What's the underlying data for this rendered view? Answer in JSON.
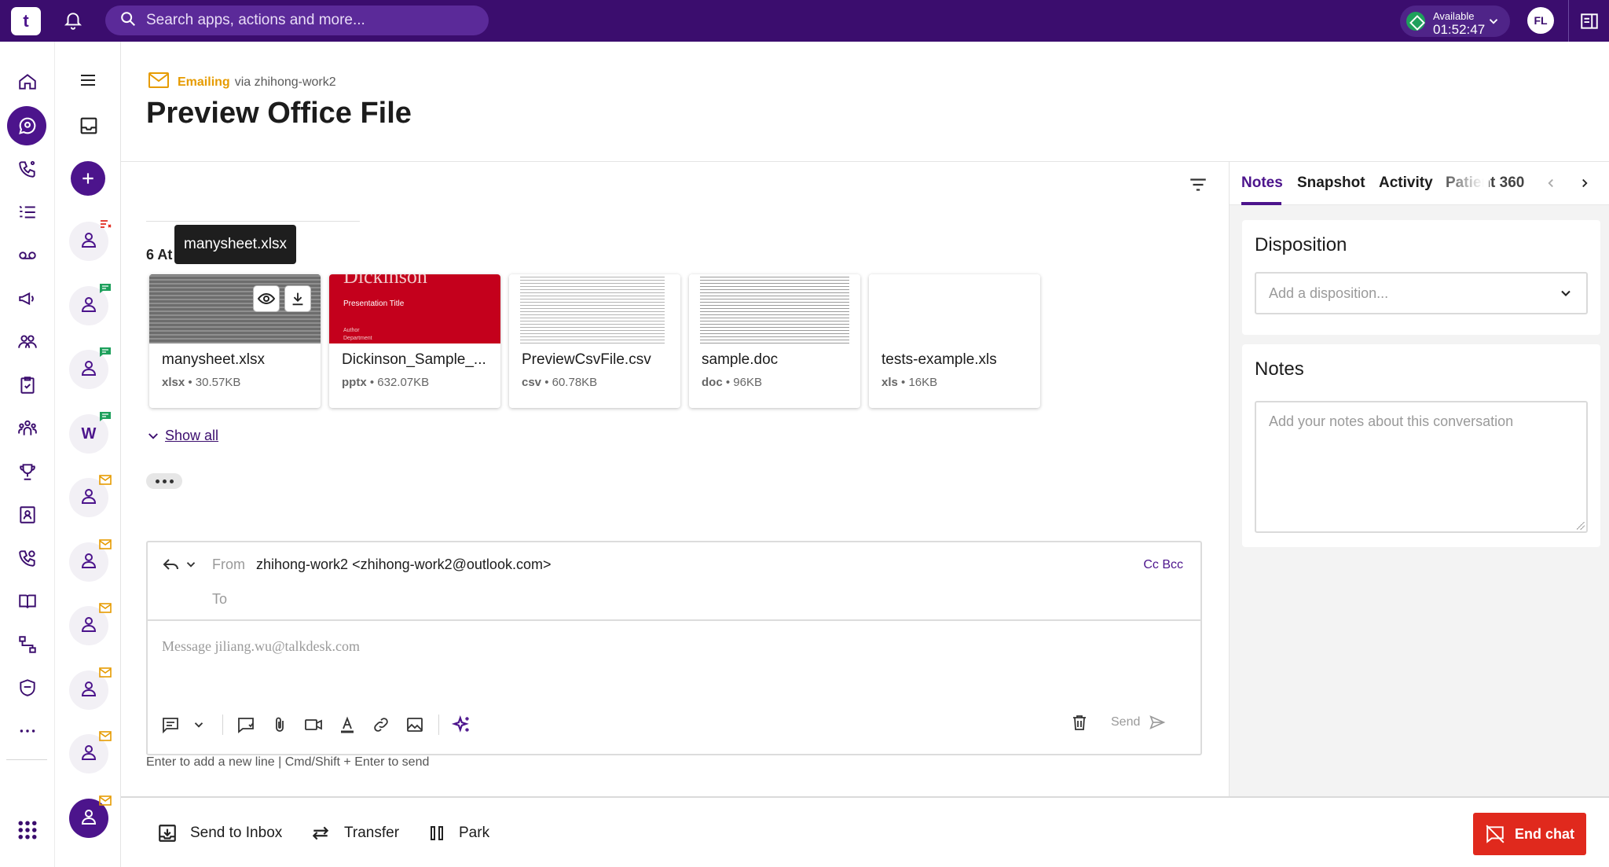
{
  "app": {
    "logo_text": "t"
  },
  "topbar": {
    "search_placeholder": "Search apps, actions and more...",
    "status_label": "Available",
    "status_timer": "01:52:47",
    "status_color": "#1ea05c",
    "user_initials": "FL"
  },
  "rail": {
    "icons": [
      "home-icon",
      "conversations-icon",
      "calls-icon",
      "queue-icon",
      "voicemail-icon",
      "campaigns-icon",
      "contacts-icon",
      "tasks-icon",
      "teams-icon",
      "trophy-icon",
      "directory-icon",
      "callback-icon",
      "knowledge-icon",
      "workflow-icon",
      "shield-icon",
      "more-icon"
    ],
    "apps_icon": "apps-grid-icon"
  },
  "conversation_list": {
    "items": [
      {
        "kind": "person",
        "badge": "missed"
      },
      {
        "kind": "person",
        "badge": "chat"
      },
      {
        "kind": "person",
        "badge": "chat"
      },
      {
        "kind": "letter",
        "letter": "W",
        "badge": "chat"
      },
      {
        "kind": "person",
        "badge": "email"
      },
      {
        "kind": "person",
        "badge": "email"
      },
      {
        "kind": "person",
        "badge": "email"
      },
      {
        "kind": "person",
        "badge": "email"
      },
      {
        "kind": "person",
        "badge": "email"
      },
      {
        "kind": "person",
        "badge": "email",
        "active": true
      }
    ]
  },
  "header": {
    "channel_type": "Emailing",
    "channel_via": "via zhihong-work2",
    "title": "Preview Office File"
  },
  "attachments": {
    "count_label": "6 At",
    "tooltip": "manysheet.xlsx",
    "items": [
      {
        "name": "manysheet.xlsx",
        "ext": "xlsx",
        "size": "30.57KB"
      },
      {
        "name": "Dickinson_Sample_...",
        "ext": "pptx",
        "size": "632.07KB",
        "thumb_heading": "Dickinson",
        "thumb_subtitle": "Presentation Title",
        "thumb_author": "Author",
        "thumb_dept": "Department"
      },
      {
        "name": "PreviewCsvFile.csv",
        "ext": "csv",
        "size": "60.78KB"
      },
      {
        "name": "sample.doc",
        "ext": "doc",
        "size": "96KB"
      },
      {
        "name": "tests-example.xls",
        "ext": "xls",
        "size": "16KB"
      }
    ],
    "show_all": "Show all"
  },
  "composer": {
    "from_label": "From",
    "from_value": "zhihong-work2 <zhihong-work2@outlook.com>",
    "to_label": "To",
    "cc_bcc": "Cc Bcc",
    "message_placeholder": "Message jiliang.wu@talkdesk.com",
    "send_label": "Send",
    "hint": "Enter to add a new line | Cmd/Shift + Enter to send"
  },
  "bottom_actions": {
    "send_to_inbox": "Send to Inbox",
    "transfer": "Transfer",
    "park": "Park",
    "end_chat": "End chat"
  },
  "right_panel": {
    "tabs": [
      "Notes",
      "Snapshot",
      "Activity",
      "Patient 360"
    ],
    "active_tab": "Notes",
    "disposition_title": "Disposition",
    "disposition_placeholder": "Add a disposition...",
    "notes_title": "Notes",
    "notes_placeholder": "Add your notes about this conversation"
  },
  "colors": {
    "brand": "#3b0d6e",
    "accent": "#4c148c",
    "email_orange": "#e69b00",
    "danger": "#e0291d"
  }
}
